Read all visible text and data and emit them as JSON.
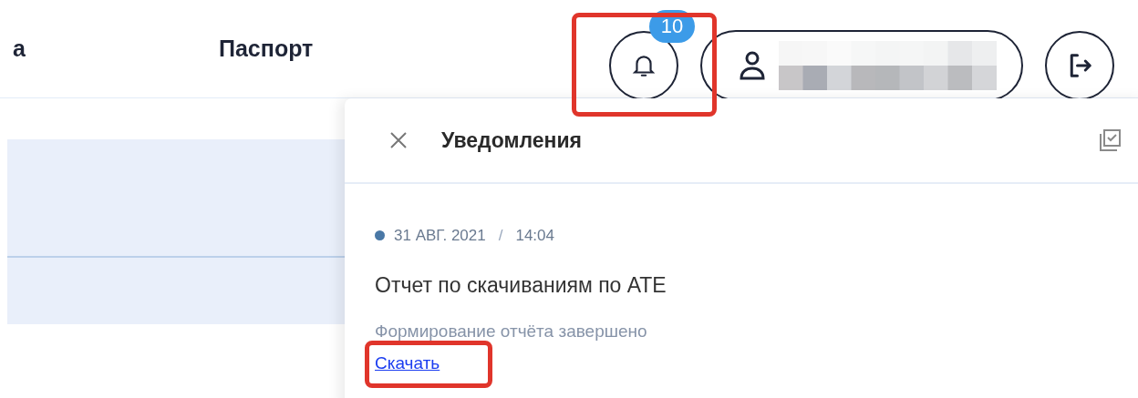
{
  "nav": [
    {
      "label": "а"
    },
    {
      "label": "Паспорт"
    }
  ],
  "notifications_button": {
    "badge": "10",
    "highlighted": true
  },
  "notifications_panel": {
    "title": "Уведомления",
    "items": [
      {
        "color": "#4a78a6",
        "date": "31 АВГ. 2021",
        "separator": "/",
        "time": "14:04",
        "title": "Отчет по скачиваниям по АТЕ",
        "message": "Формирование отчёта завершено",
        "link": {
          "label": "Скачать",
          "highlighted": true
        }
      }
    ]
  }
}
